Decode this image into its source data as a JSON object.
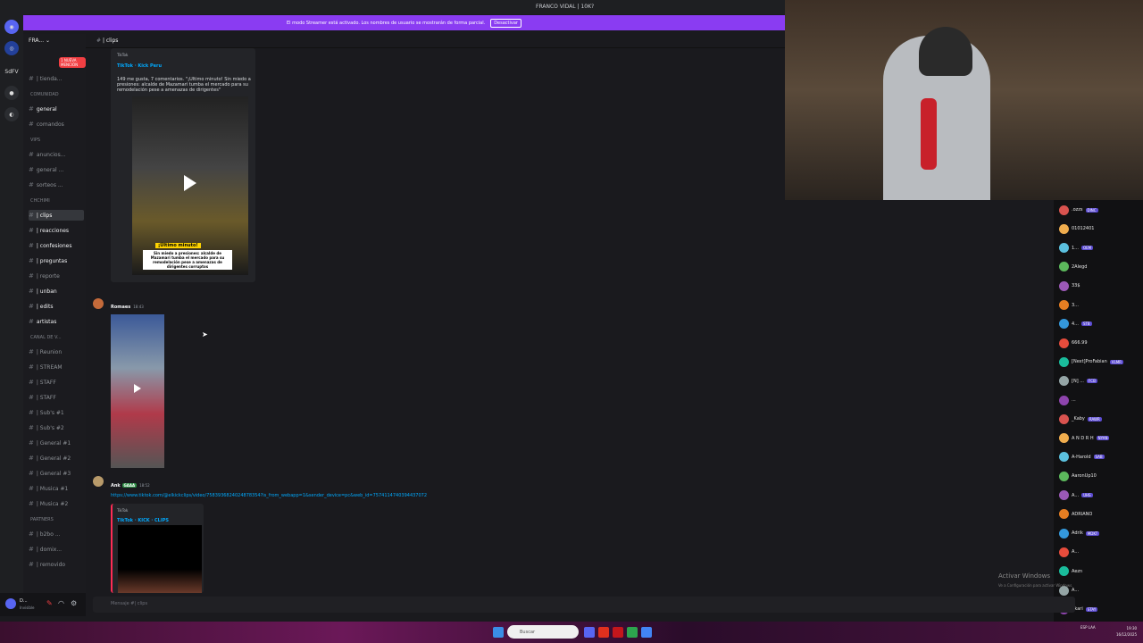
{
  "window": {
    "title": "FRANCO VIDAL | 10K?"
  },
  "banner": {
    "text": "El modo Streamer está activado. Los nombres de usuario se mostrarán de forma parcial.",
    "button": "Desactivar"
  },
  "rail": {
    "label_sdfv": "SdFV"
  },
  "server": {
    "name": "FRA...",
    "mention_badge": "1 NUEVA MENCIÓN"
  },
  "sidebar": {
    "items": [
      {
        "type": "channel",
        "label": "| tienda..."
      },
      {
        "type": "category",
        "label": "COMUNIDAD"
      },
      {
        "type": "channel",
        "label": "general",
        "bold": true
      },
      {
        "type": "channel",
        "label": "comandos"
      },
      {
        "type": "category",
        "label": "VIPS"
      },
      {
        "type": "channel",
        "label": "anuncios..."
      },
      {
        "type": "channel",
        "label": "general ..."
      },
      {
        "type": "channel",
        "label": "sorteos ..."
      },
      {
        "type": "category",
        "label": "CHCHIMI"
      },
      {
        "type": "channel",
        "label": "| clips",
        "active": true
      },
      {
        "type": "channel",
        "label": "| reacciones",
        "bold": true
      },
      {
        "type": "channel",
        "label": "| confesiones",
        "bold": true
      },
      {
        "type": "channel",
        "label": "| preguntas",
        "bold": true
      },
      {
        "type": "channel",
        "label": "| reporte"
      },
      {
        "type": "channel",
        "label": "| unban",
        "bold": true
      },
      {
        "type": "channel",
        "label": "| edits",
        "bold": true
      },
      {
        "type": "channel",
        "label": "artistas",
        "bold": true
      },
      {
        "type": "category",
        "label": "CANAL DE V..."
      },
      {
        "type": "channel",
        "label": "| Reunion"
      },
      {
        "type": "channel",
        "label": "| STREAM"
      },
      {
        "type": "channel",
        "label": "| STAFF"
      },
      {
        "type": "channel",
        "label": "| STAFF"
      },
      {
        "type": "channel",
        "label": "| Sub's #1"
      },
      {
        "type": "channel",
        "label": "| Sub's #2"
      },
      {
        "type": "channel",
        "label": "| General #1"
      },
      {
        "type": "channel",
        "label": "| General #2"
      },
      {
        "type": "channel",
        "label": "| General #3"
      },
      {
        "type": "channel",
        "label": "| Musica #1"
      },
      {
        "type": "channel",
        "label": "| Musica #2"
      },
      {
        "type": "category",
        "label": "PARTNERS"
      },
      {
        "type": "channel",
        "label": "| b2bo ..."
      },
      {
        "type": "channel",
        "label": "| domix..."
      },
      {
        "type": "channel",
        "label": "| removido"
      }
    ]
  },
  "chat": {
    "channel_title": "| clips",
    "embed1": {
      "site": "TikTok",
      "title": "TikTok · Kick Peru",
      "desc": "149 me gusta, 7 comentarios. \"¡Último minuto! Sin miedo a presiones: alcalde de Mazamari tumba el mercado para su remodelación pese a amenazas de dirigentes\"",
      "video_caption_top": "¡Último minuto!",
      "video_caption": "Sin miedo a presiones: alcalde de Mazamari tumba el mercado para su remodelación pese a amenazas de dirigentes corruptos"
    },
    "msg2": {
      "author": "Romaes",
      "time": "18:43"
    },
    "msg3": {
      "author": "Ank",
      "tag": "GAAA",
      "time": "18:52",
      "link": "https://www.tiktok.com/@elkickclips/video/7583936824024878354?is_from_webapp=1&sender_device=pc&web_id=7574114740394437072",
      "embed_site": "TikTok",
      "embed_title": "TikTok · KICK · CLIPS"
    },
    "message_placeholder": "Mensaje #| clips"
  },
  "user": {
    "name": "D...",
    "status": "Invisible"
  },
  "stream_chat": {
    "rows": [
      {
        "name": ".ozzs",
        "badge": "DINC"
      },
      {
        "name": "01012401",
        "badge": ""
      },
      {
        "name": "1...",
        "badge": "OEM"
      },
      {
        "name": "2Alegd",
        "badge": ""
      },
      {
        "name": "33$",
        "badge": ""
      },
      {
        "name": "3...",
        "badge": ""
      },
      {
        "name": "4...",
        "badge": "STB"
      },
      {
        "name": "666.99",
        "badge": ""
      },
      {
        "name": "[Next]ProFabian",
        "badge": "VLMR"
      },
      {
        "name": "[N] ...",
        "badge": "FCB"
      },
      {
        "name": "...",
        "badge": ""
      },
      {
        "name": "_Kaby",
        "badge": "RAWR"
      },
      {
        "name": "A N D R H",
        "badge": "NYAN"
      },
      {
        "name": "A-Harold",
        "badge": "SAB"
      },
      {
        "name": "AaronUp10",
        "badge": ""
      },
      {
        "name": "A...",
        "badge": "UHS"
      },
      {
        "name": "ADRIANO",
        "badge": ""
      },
      {
        "name": "Adrik",
        "badge": "MDKT"
      },
      {
        "name": "A...",
        "badge": ""
      },
      {
        "name": "Aezn",
        "badge": ""
      },
      {
        "name": "A...",
        "badge": ""
      },
      {
        "name": "Akari",
        "badge": "STAY"
      }
    ]
  },
  "watermark": {
    "line1": "Activar Windows",
    "line2": "Ve a Configuración para activar Windows."
  },
  "taskbar": {
    "search": "Buscar",
    "time": "19:30",
    "date": "16/12/2025",
    "lang": "ESP LAA"
  },
  "colors": {
    "accent": "#8a3cf2",
    "link": "#00a8fc",
    "mention": "#f23f43"
  }
}
